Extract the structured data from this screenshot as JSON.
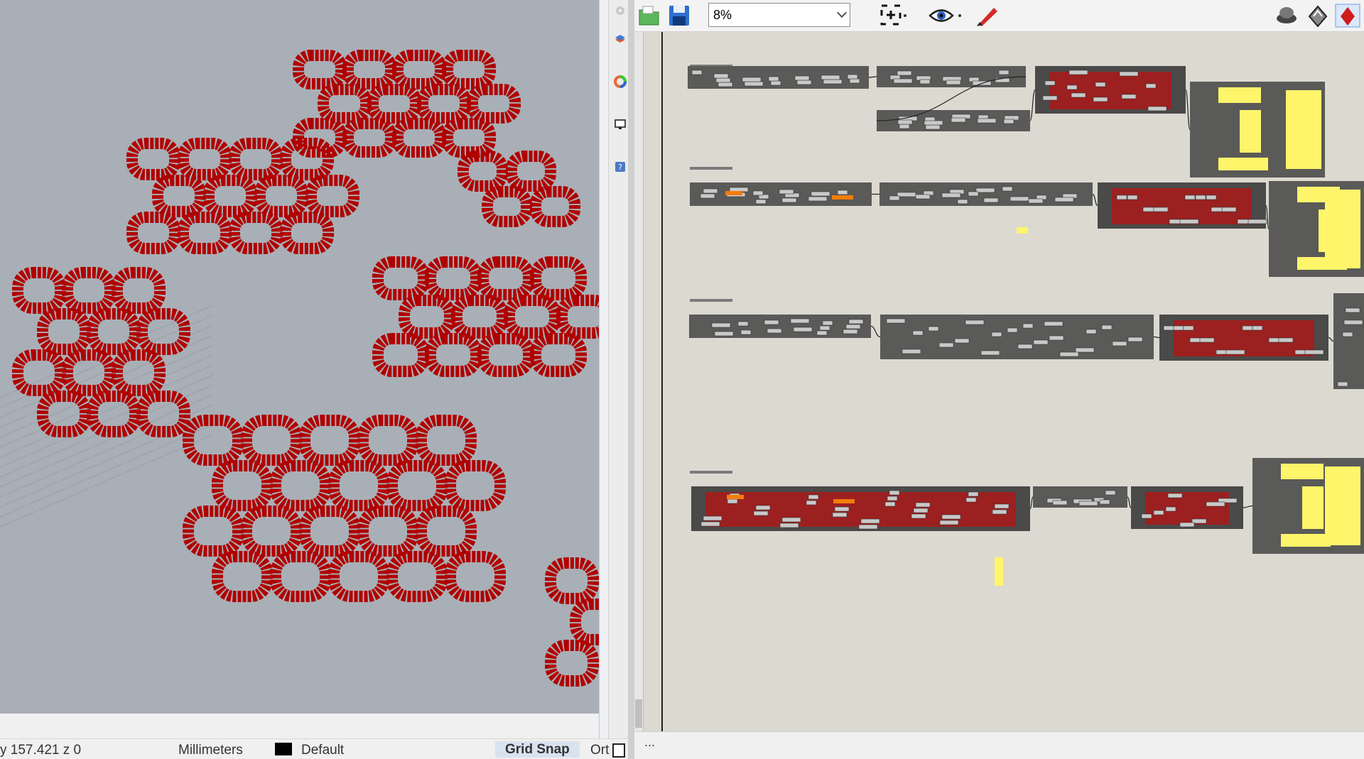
{
  "viewport": {
    "name": "Rhino viewport",
    "pattern_color": "#b00000",
    "background_color": "#a9afb6"
  },
  "statusbar": {
    "coords": "y 157.421  z 0",
    "units": "Millimeters",
    "layer": "Default",
    "grid_snap": "Grid Snap",
    "ortho": "Ort"
  },
  "grasshopper": {
    "zoom": "8%",
    "bottom_text": "...",
    "colors": {
      "canvas": "#dcd9d1",
      "group_grey": "#5a5a58",
      "group_red": "#9c2020",
      "group_dark": "#4a4a48",
      "panel_yellow": "#fef56a",
      "accent_orange": "#f27d0c"
    }
  },
  "toolbar_icons": {
    "open": "folder-open-icon",
    "save": "save-icon",
    "zoom_extents": "zoom-extents-icon",
    "preview": "eye-icon",
    "sketch": "pen-icon",
    "right1": "shaded-preview-icon",
    "right2": "wireframe-preview-icon",
    "right3": "render-icon"
  }
}
